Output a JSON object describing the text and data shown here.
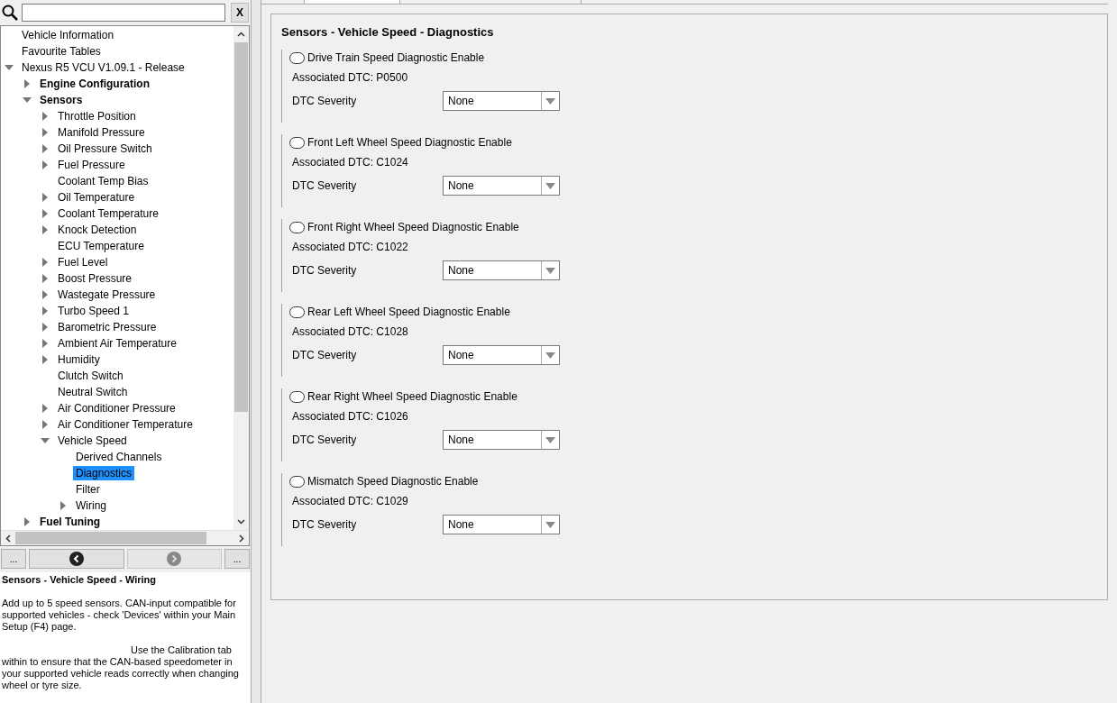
{
  "search": {
    "clear_label": "X"
  },
  "tree": [
    {
      "label": "Vehicle Information",
      "kind": "leaf",
      "selected": false
    },
    {
      "label": "Favourite Tables",
      "kind": "leaf",
      "selected": false
    },
    {
      "label": "Nexus R5 VCU V1.09.1 - Release",
      "kind": "node",
      "expanded": true,
      "selected": false,
      "children": [
        {
          "label": "Engine Configuration",
          "kind": "node",
          "expanded": false,
          "selected": false
        },
        {
          "label": "Sensors",
          "kind": "node",
          "expanded": true,
          "selected": false,
          "children": [
            {
              "label": "Throttle Position",
              "kind": "node",
              "expanded": false,
              "selected": false
            },
            {
              "label": "Manifold Pressure",
              "kind": "node",
              "expanded": false,
              "selected": false
            },
            {
              "label": "Oil Pressure Switch",
              "kind": "node",
              "expanded": false,
              "selected": false
            },
            {
              "label": "Fuel Pressure",
              "kind": "node",
              "expanded": false,
              "selected": false
            },
            {
              "label": "Coolant Temp Bias",
              "kind": "leaf",
              "selected": false
            },
            {
              "label": "Oil Temperature",
              "kind": "node",
              "expanded": false,
              "selected": false
            },
            {
              "label": "Coolant Temperature",
              "kind": "node",
              "expanded": false,
              "selected": false
            },
            {
              "label": "Knock Detection",
              "kind": "node",
              "expanded": false,
              "selected": false
            },
            {
              "label": "ECU Temperature",
              "kind": "leaf",
              "selected": false
            },
            {
              "label": "Fuel Level",
              "kind": "node",
              "expanded": false,
              "selected": false
            },
            {
              "label": "Boost Pressure",
              "kind": "node",
              "expanded": false,
              "selected": false
            },
            {
              "label": "Wastegate Pressure",
              "kind": "node",
              "expanded": false,
              "selected": false
            },
            {
              "label": "Turbo Speed 1",
              "kind": "node",
              "expanded": false,
              "selected": false
            },
            {
              "label": "Barometric Pressure",
              "kind": "node",
              "expanded": false,
              "selected": false
            },
            {
              "label": "Ambient Air Temperature",
              "kind": "node",
              "expanded": false,
              "selected": false
            },
            {
              "label": "Humidity",
              "kind": "node",
              "expanded": false,
              "selected": false
            },
            {
              "label": "Clutch Switch",
              "kind": "leaf",
              "selected": false
            },
            {
              "label": "Neutral Switch",
              "kind": "leaf",
              "selected": false
            },
            {
              "label": "Air Conditioner Pressure",
              "kind": "node",
              "expanded": false,
              "selected": false
            },
            {
              "label": "Air Conditioner Temperature",
              "kind": "node",
              "expanded": false,
              "selected": false
            },
            {
              "label": "Vehicle Speed",
              "kind": "node",
              "expanded": true,
              "selected": false,
              "children": [
                {
                  "label": "Derived Channels",
                  "kind": "leaf",
                  "selected": false
                },
                {
                  "label": "Diagnostics",
                  "kind": "leaf",
                  "selected": true
                },
                {
                  "label": "Filter",
                  "kind": "leaf",
                  "selected": false
                },
                {
                  "label": "Wiring",
                  "kind": "node",
                  "expanded": false,
                  "selected": false
                }
              ]
            }
          ]
        },
        {
          "label": "Fuel Tuning",
          "kind": "node",
          "expanded": false,
          "selected": false
        }
      ]
    }
  ],
  "nav": {
    "left_label": "...",
    "right_label": "..."
  },
  "help": {
    "title": "Sensors - Vehicle Speed - Wiring",
    "paragraphs": [
      {
        "text": "Add up to 5 speed sensors. CAN-input compatible for supported vehicles - check 'Devices' within your Main Setup (F4) page.",
        "indented": false
      },
      {
        "text": "Use the Calibration tab within to ensure that the CAN-based speedometer in your supported vehicle reads correctly when changing wheel or tyre size.",
        "indented": true
      }
    ]
  },
  "panel": {
    "title": "Sensors - Vehicle Speed - Diagnostics",
    "groups": [
      {
        "label": "Drive Train Speed Diagnostic Enable",
        "checked": false,
        "dtc": "Associated DTC: P0500",
        "severity_label": "DTC Severity",
        "severity": "None"
      },
      {
        "label": "Front Left Wheel Speed Diagnostic Enable",
        "checked": false,
        "dtc": "Associated DTC: C1024",
        "severity_label": "DTC Severity",
        "severity": "None"
      },
      {
        "label": "Front Right Wheel Speed Diagnostic Enable",
        "checked": false,
        "dtc": "Associated DTC: C1022",
        "severity_label": "DTC Severity",
        "severity": "None"
      },
      {
        "label": "Rear Left Wheel Speed Diagnostic Enable",
        "checked": false,
        "dtc": "Associated DTC: C1028",
        "severity_label": "DTC Severity",
        "severity": "None"
      },
      {
        "label": "Rear Right Wheel Speed Diagnostic Enable",
        "checked": false,
        "dtc": "Associated DTC: C1026",
        "severity_label": "DTC Severity",
        "severity": "None"
      },
      {
        "label": "Mismatch Speed Diagnostic Enable",
        "checked": false,
        "dtc": "Associated DTC: C1029",
        "severity_label": "DTC Severity",
        "severity": "None"
      }
    ]
  }
}
